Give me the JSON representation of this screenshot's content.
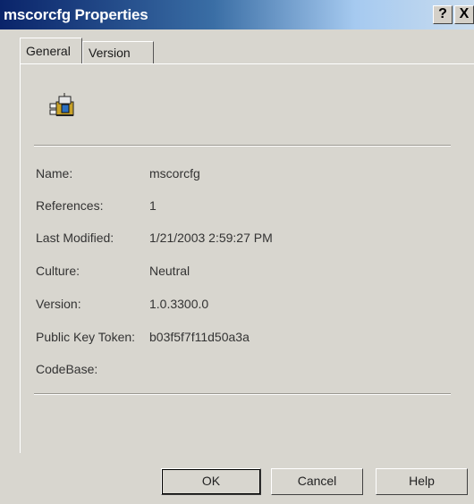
{
  "window": {
    "title": "mscorcfg Properties",
    "help_glyph": "?",
    "close_glyph": "X"
  },
  "tabs": [
    {
      "label": "General",
      "selected": true
    },
    {
      "label": "Version",
      "selected": false
    }
  ],
  "icon": "assembly-component-icon",
  "properties": [
    {
      "label": "Name:",
      "value": "mscorcfg"
    },
    {
      "label": "References:",
      "value": "1"
    },
    {
      "label": "Last Modified:",
      "value": "1/21/2003 2:59:27 PM"
    },
    {
      "label": "Culture:",
      "value": "Neutral"
    },
    {
      "label": "Version:",
      "value": "1.0.3300.0"
    },
    {
      "label": "Public Key Token:",
      "value": "b03f5f7f11d50a3a"
    },
    {
      "label": "CodeBase:",
      "value": ""
    }
  ],
  "buttons": {
    "ok": "OK",
    "cancel": "Cancel",
    "help": "Help"
  },
  "colors": {
    "titlebar_start": "#0a246a",
    "titlebar_end": "#c9dcee",
    "dialog_face": "#d8d6cf"
  }
}
